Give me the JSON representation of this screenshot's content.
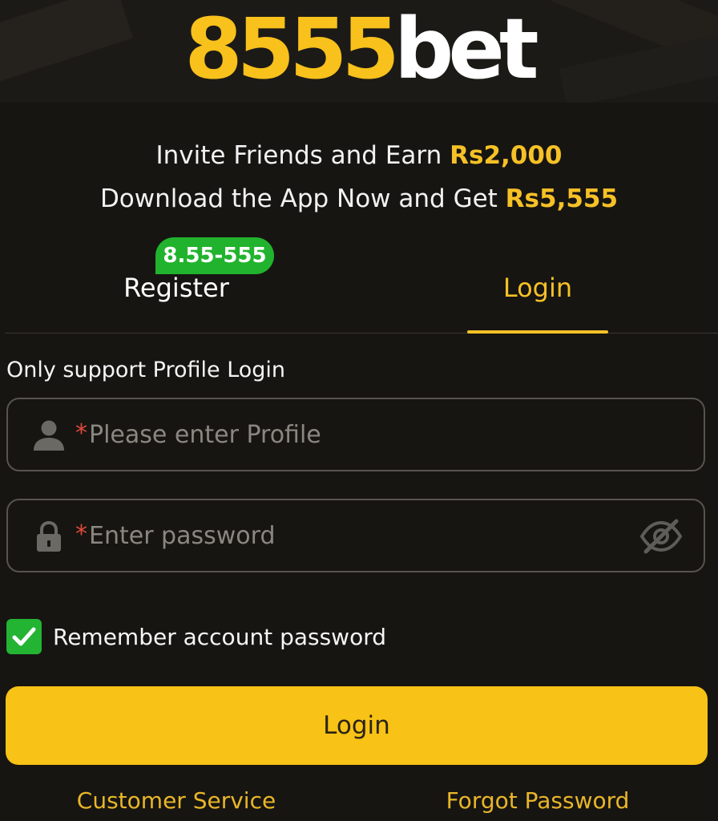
{
  "header": {
    "logo_number": "8555",
    "logo_word": "bet"
  },
  "promo": {
    "line1_text": "Invite Friends and Earn ",
    "line1_amount": "Rs2,000",
    "line2_text": "Download the App Now and Get ",
    "line2_amount": "Rs5,555"
  },
  "tabs": {
    "register_label": "Register",
    "register_badge": "8.55-555",
    "login_label": "Login",
    "active": "login"
  },
  "form": {
    "support_note": "Only support Profile Login",
    "required_mark": "*",
    "profile": {
      "placeholder": "Please enter Profile",
      "value": ""
    },
    "password": {
      "placeholder": "Enter password",
      "value": ""
    },
    "remember": {
      "label": "Remember account password",
      "checked": true
    },
    "submit_label": "Login"
  },
  "footer": {
    "customer_service": "Customer Service",
    "forgot_password": "Forgot Password"
  },
  "icons": {
    "profile": "user-icon",
    "password": "lock-icon",
    "toggle": "eye-off-icon",
    "checkbox": "checkmark-icon"
  },
  "colors": {
    "background": "#171512",
    "accent": "#f8c216",
    "badge": "#21b32d",
    "checkbox": "#22b432",
    "required": "#e04a3a"
  }
}
